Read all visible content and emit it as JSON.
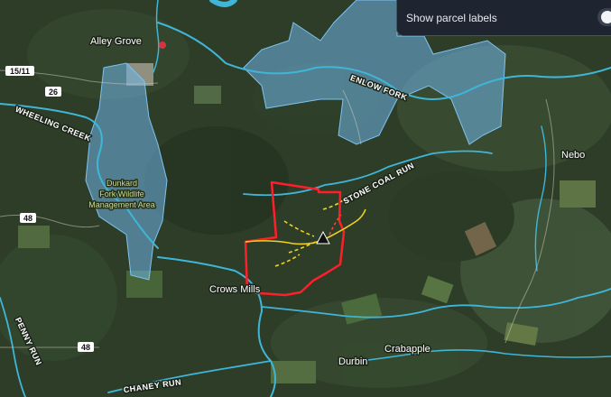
{
  "toggle": {
    "label": "Show parcel labels",
    "checked": false
  },
  "places": {
    "alley_grove": "Alley Grove",
    "nebo": "Nebo",
    "crows_mills": "Crows Mills",
    "crabapple": "Crabapple",
    "durbin": "Durbin"
  },
  "rivers": {
    "wheeling_creek": "WHEELING CREEK",
    "enlow_fork": "ENLOW FORK",
    "stone_coal_run": "STONE COAL RUN",
    "chaney_run": "CHANEY RUN",
    "penny_run": "PENNY RUN"
  },
  "wma": {
    "line1": "Dunkard",
    "line2": "Fork Wildlife",
    "line3": "Management Area"
  },
  "routes": {
    "us_route": "15/11",
    "route_26": "26",
    "route_48_upper": "48",
    "route_48_lower": "48"
  },
  "colors": {
    "parcel_boundary": "#ff1f2a",
    "trail": "#f2d21c",
    "water": "#3fb6d8",
    "protected_area": "#6fb6e8"
  },
  "icons": {
    "marker": "triangle-marker-icon"
  }
}
